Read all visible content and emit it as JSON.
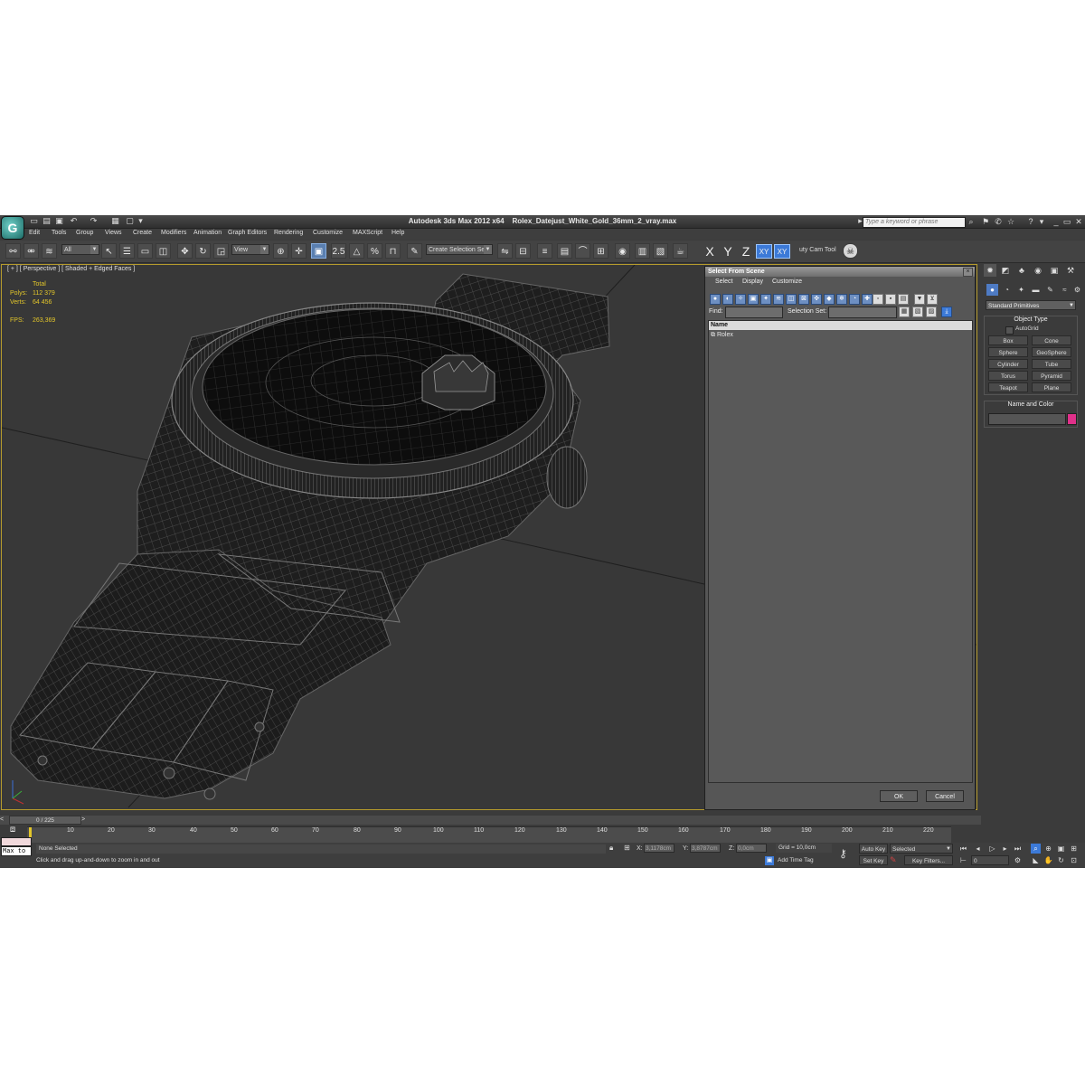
{
  "window": {
    "app_title": "Autodesk 3ds Max  2012 x64",
    "file_title": "Rolex_Datejust_White_Gold_36mm_2_vray.max",
    "search_placeholder": "Type a keyword or phrase"
  },
  "menu": [
    "Edit",
    "Tools",
    "Group",
    "Views",
    "Create",
    "Modifiers",
    "Animation",
    "Graph Editors",
    "Rendering",
    "Customize",
    "MAXScript",
    "Help"
  ],
  "toolbar": {
    "filter_value": "All",
    "ref_coord_value": "View",
    "snap_label": "2.5",
    "angle_label": "%",
    "named_selection_placeholder": "Create Selection Se",
    "axis": [
      "X",
      "Y",
      "Z",
      "XY",
      "XY"
    ],
    "cam_tool_label": "uty Cam Tool"
  },
  "viewport": {
    "label": "[ + ] [ Perspective ] [ Shaded + Edged Faces ]",
    "stats": {
      "total_label": "Total",
      "polys_label": "Polys:",
      "polys_value": "112 379",
      "verts_label": "Verts:",
      "verts_value": "64 456",
      "fps_label": "FPS:",
      "fps_value": "263,369"
    }
  },
  "dialog": {
    "title": "Select From Scene",
    "close": "×",
    "menu": [
      "Select",
      "Display",
      "Customize"
    ],
    "find_label": "Find:",
    "selection_set_label": "Selection Set:",
    "column_name": "Name",
    "items": [
      "Rolex"
    ],
    "ok": "OK",
    "cancel": "Cancel"
  },
  "command_panel": {
    "category": "Standard Primitives",
    "object_type_title": "Object Type",
    "autogrid": "AutoGrid",
    "primitives": [
      "Box",
      "Cone",
      "Sphere",
      "GeoSphere",
      "Cylinder",
      "Tube",
      "Torus",
      "Pyramid",
      "Teapot",
      "Plane"
    ],
    "name_color_title": "Name and Color",
    "object_color": "#e0308a"
  },
  "timeline": {
    "frame": "0 / 225",
    "ticks": [
      "10",
      "20",
      "30",
      "40",
      "50",
      "60",
      "70",
      "80",
      "90",
      "100",
      "110",
      "120",
      "130",
      "140",
      "150",
      "160",
      "170",
      "180",
      "190",
      "200",
      "210",
      "220"
    ]
  },
  "status": {
    "maxscript": "Max to",
    "selection": "None Selected",
    "prompt": "Click and drag up-and-down to zoom in and out",
    "x_label": "X:",
    "x_value": "3,1178cm",
    "y_label": "Y:",
    "y_value": "3,8787cm",
    "z_label": "Z:",
    "z_value": "0,0cm",
    "grid": "Grid = 10,0cm",
    "add_time_tag": "Add Time Tag",
    "auto_key": "Auto Key",
    "set_key": "Set Key",
    "selected": "Selected",
    "key_filters": "Key Filters...",
    "current_frame": "0"
  },
  "colors": {
    "viewport_border": "#b59b2c",
    "stats_text": "#e3c62a",
    "active_blue": "#3c7ad8"
  }
}
